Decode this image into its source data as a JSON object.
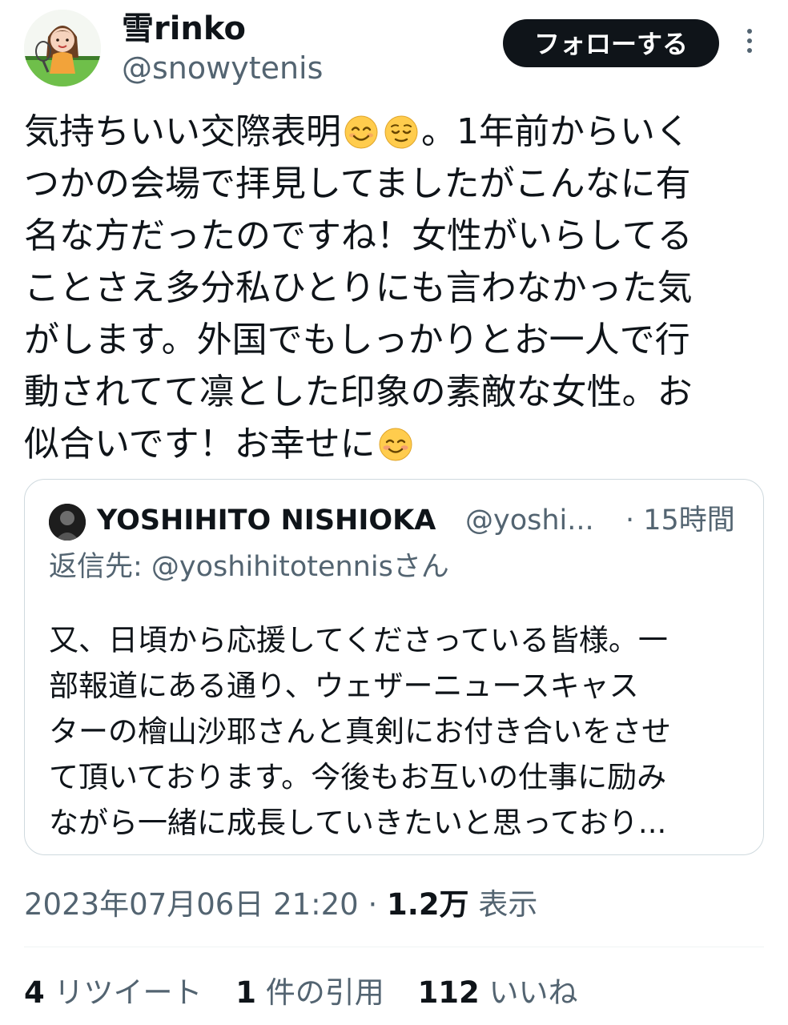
{
  "author": {
    "display_name": "雪rinko",
    "handle": "@snowytenis",
    "follow_label": "フォローする"
  },
  "tweet": {
    "lines": [
      {
        "before": "気持ちいい交際表明",
        "emojis": [
          "smiling-face-with-smiling-eyes",
          "relieved-face"
        ],
        "after": "。1年前からいく"
      },
      {
        "text": "つかの会場で拝見してましたがこんなに有"
      },
      {
        "text": "名な方だったのですね！女性がいらしてる"
      },
      {
        "text": "ことさえ多分私ひとりにも言わなかった気"
      },
      {
        "text": "がします。外国でもしっかりとお一人で行"
      },
      {
        "text": "動されてて凛とした印象の素敵な女性。お"
      },
      {
        "before": "似合いです！お幸せに",
        "emojis": [
          "smiling-face"
        ],
        "after": ""
      }
    ]
  },
  "quote": {
    "name": "YOSHIHITO NISHIOKA",
    "handle": "@yoshi...",
    "time": "· 15時間",
    "reply_to": "返信先: @yoshihitotennisさん",
    "lines": [
      "又、日頃から応援してくださっている皆様。一",
      "部報道にある通り、ウェザーニュースキャス",
      "ターの檜山沙耶さんと真剣にお付き合いをさせ",
      "て頂いております。今後もお互いの仕事に励み",
      "ながら一緒に成長していきたいと思っており..."
    ]
  },
  "meta": {
    "timestamp": "2023年07月06日 21:20",
    "separator": " · ",
    "views_count": "1.2万",
    "views_label": " 表示"
  },
  "stats": {
    "retweets_count": "4",
    "retweets_label": " リツイート",
    "quotes_count": "1",
    "quotes_label": " 件の引用",
    "likes_count": "112",
    "likes_label": " いいね"
  },
  "colors": {
    "text_primary": "#0f1419",
    "text_secondary": "#536471",
    "border": "#cfd9de",
    "follow_button_bg": "#0f1419",
    "emoji_face": "#ffcc4d"
  }
}
